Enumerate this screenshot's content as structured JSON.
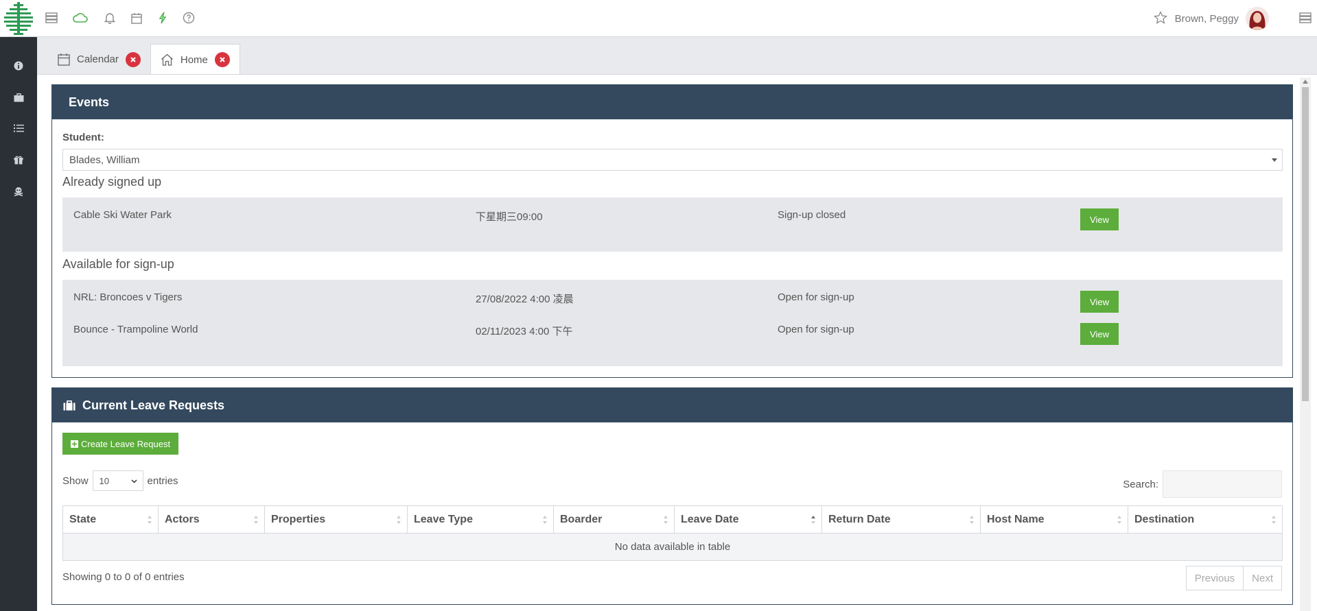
{
  "header": {
    "user_name": "Brown, Peggy",
    "icons": [
      "menu-icon",
      "cloud-icon",
      "bell-icon",
      "calendar-icon",
      "bolt-icon",
      "help-icon",
      "star-icon",
      "grid-menu-icon"
    ],
    "accent_color": "#2e9a55"
  },
  "sidebar": {
    "items": [
      "info-icon",
      "briefcase-icon",
      "list-icon",
      "gift-icon",
      "skull-icon"
    ]
  },
  "tabs": [
    {
      "label": "Calendar",
      "icon": "calendar-icon"
    },
    {
      "label": "Home",
      "icon": "home-icon"
    }
  ],
  "events": {
    "title": "Events",
    "student_label": "Student:",
    "student_value": "Blades, William",
    "signed_up_title": "Already signed up",
    "signed_up": [
      {
        "name": "Cable Ski Water Park",
        "date": "下星期三09:00",
        "status": "Sign-up closed",
        "action": "View"
      }
    ],
    "available_title": "Available for sign-up",
    "available": [
      {
        "name": "NRL: Broncoes v Tigers",
        "date": "27/08/2022 4:00 凌晨",
        "status": "Open for sign-up",
        "action": "View"
      },
      {
        "name": "Bounce - Trampoline World",
        "date": "02/11/2023 4:00 下午",
        "status": "Open for sign-up",
        "action": "View"
      }
    ]
  },
  "leave": {
    "title": "Current Leave Requests",
    "create_label": "Create Leave Request",
    "show_label": "Show",
    "entries_value": "10",
    "entries_label": "entries",
    "search_label": "Search:",
    "columns": [
      "State",
      "Actors",
      "Properties",
      "Leave Type",
      "Boarder",
      "Leave Date",
      "Return Date",
      "Host Name",
      "Destination"
    ],
    "empty_text": "No data available in table",
    "info": "Showing 0 to 0 of 0 entries",
    "prev_label": "Previous",
    "next_label": "Next"
  },
  "colors": {
    "panel_header": "#34495e",
    "view_button": "#5cad3b",
    "close_button": "#d9333f",
    "sidebar": "#2b3036"
  }
}
